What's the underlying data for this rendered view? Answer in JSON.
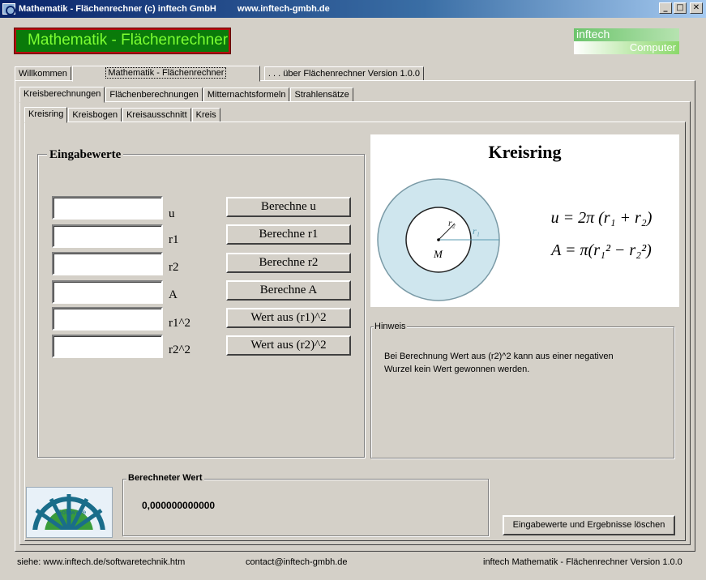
{
  "window": {
    "title": "Mathematik - Flächenrechner (c) inftech GmbH",
    "url": "www.inftech-gmbh.de",
    "btn_min": "_",
    "btn_max": "□",
    "btn_close": "✕"
  },
  "header": {
    "app_title": "Mathematik - Flächenrechner",
    "logo_top": "inftech",
    "logo_bottom": "Computer"
  },
  "main_tabs": [
    "Willkommen",
    "Mathematik - Flächenrechner",
    ". . . über Flächenrechner Version 1.0.0"
  ],
  "sub_tabs": [
    "Kreisberechnungen",
    "Flächenberechnungen",
    "Mitternachtsformeln",
    "Strahlensätze"
  ],
  "circle_tabs": [
    "Kreisring",
    "Kreisbogen",
    "Kreisausschnitt",
    "Kreis"
  ],
  "inputs": {
    "group_label": "Eingabewerte",
    "rows": [
      {
        "label": "u",
        "button": "Berechne  u",
        "value": ""
      },
      {
        "label": "r1",
        "button": "Berechne  r1",
        "value": ""
      },
      {
        "label": "r2",
        "button": "Berechne  r2",
        "value": ""
      },
      {
        "label": "A",
        "button": "Berechne  A",
        "value": ""
      },
      {
        "label": "r1^2",
        "button": "Wert aus (r1)^2",
        "value": ""
      },
      {
        "label": "r2^2",
        "button": "Wert aus (r2)^2",
        "value": ""
      }
    ]
  },
  "figure": {
    "title": "Kreisring",
    "label_r1": "r₁",
    "label_r2": "r₂",
    "label_m": "M",
    "formula_u": "u = 2π (r₁ + r₂)",
    "formula_a": "A = π(r₁² − r₂²)"
  },
  "hint": {
    "label": "Hinweis",
    "text_line1": "Bei Berechnung  Wert aus  (r2)^2 kann aus einer negativen",
    "text_line2": "Wurzel kein Wert gewonnen werden."
  },
  "result": {
    "label": "Berechneter Wert",
    "value": "0,000000000000"
  },
  "reset_button": "Eingabewerte und Ergebnisse löschen",
  "logo_text": "Software",
  "status": {
    "left": "siehe: www.inftech.de/softwaretechnik.htm",
    "middle": "contact@inftech-gmbh.de",
    "right": "inftech Mathematik - Flächenrechner Version 1.0.0"
  },
  "colors": {
    "titlebar": "#0a246a",
    "header_bg": "#0a7a0a",
    "header_text": "#7cff32",
    "header_border": "#b30f0f",
    "ring_fill": "#cfe6ee"
  }
}
